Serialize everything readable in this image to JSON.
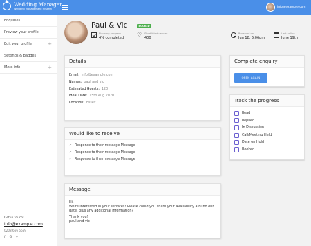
{
  "app": {
    "title": "Wedding Manager",
    "subtitle": "Wedding Management System",
    "user_email": "info@example.com"
  },
  "sidebar": {
    "items": [
      {
        "label": "Enquiries",
        "expandable": false
      },
      {
        "label": "Preview your profile",
        "expandable": false
      },
      {
        "label": "Edit your profile",
        "expandable": true
      },
      {
        "label": "Settings & Badges",
        "expandable": false
      },
      {
        "label": "More info",
        "expandable": true
      }
    ],
    "footer": {
      "heading": "Get in touch!",
      "email": "info@example.com",
      "phone": "0208 666 6659",
      "socials": [
        "f",
        "G",
        "v"
      ]
    }
  },
  "profile": {
    "names": "Paul & Vic",
    "badge": "BOOKED",
    "stats": [
      {
        "icon": "check-box-icon",
        "label": "Planning progress",
        "value": "4% completed"
      },
      {
        "icon": "heart-icon",
        "label": "Shortlisted venues",
        "value": "400"
      },
      {
        "icon": "clock-icon",
        "label": "Received on",
        "value": "Jun 18, 5:06pm"
      },
      {
        "icon": "calendar-icon",
        "label": "Last online",
        "value": "June 19th"
      }
    ]
  },
  "details": {
    "title": "Details",
    "rows": [
      {
        "key": "Email:",
        "value": "info@example.com"
      },
      {
        "key": "Names:",
        "value": "paul and vic"
      },
      {
        "key": "Estimated Guests:",
        "value": "120"
      },
      {
        "key": "Ideal Date:",
        "value": "15th Aug 2020"
      },
      {
        "key": "Location:",
        "value": "Essex"
      }
    ]
  },
  "receive": {
    "title": "Would like to receive",
    "items": [
      "Response to their message Message",
      "Response to their message Message",
      "Response to their message Message"
    ]
  },
  "message": {
    "title": "Message",
    "greeting": "Hi,",
    "body": "We're interested in your services! Please could you share your availability around our date, plus any additional information?",
    "thanks": "Thank you!",
    "sign": "paul and vic"
  },
  "enquiry": {
    "title": "Complete enquiry",
    "button": "OPEN AGAIN"
  },
  "progress": {
    "title": "Track the progress",
    "items": [
      "Read",
      "Replied",
      "In Discussion",
      "Call/Meeting Held",
      "Date on Hold",
      "Booked"
    ]
  },
  "colors": {
    "accent": "#4a8fe8",
    "badge": "#4cae4c",
    "checkbox": "#6a5fd0"
  }
}
